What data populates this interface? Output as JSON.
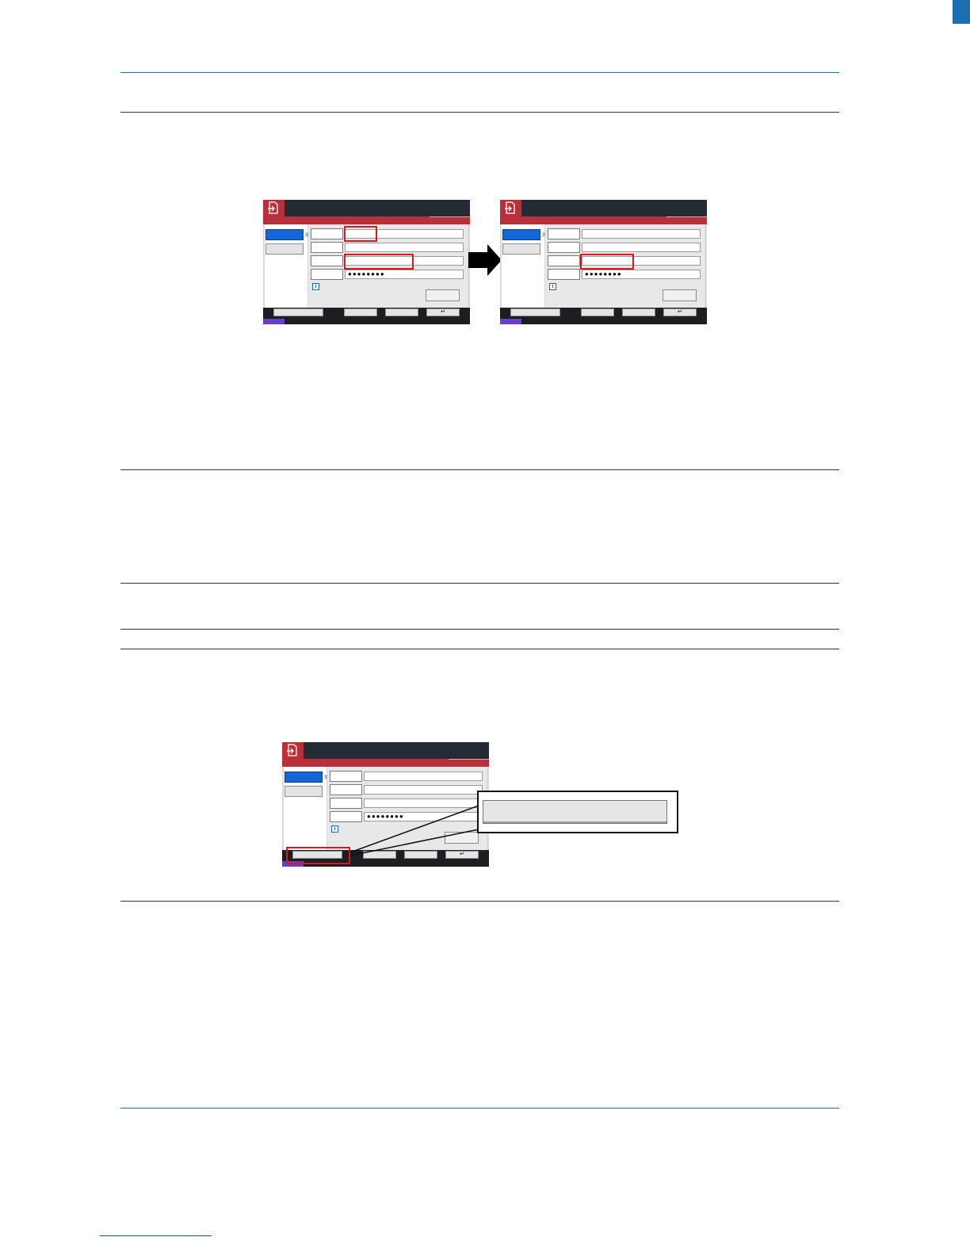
{
  "panels": {
    "masked_password": "●●●●●●●●",
    "enter_key_glyph": "↵",
    "info_glyph": "i"
  },
  "colors": {
    "header_rule": "#1a6fb3",
    "highlight": "#d11a22",
    "panel_logo": "#b8303a",
    "active_tab": "#1567d8"
  },
  "icons": {
    "panel_logo": "document-arrow-icon",
    "flow_arrow": "arrow-right-icon"
  }
}
